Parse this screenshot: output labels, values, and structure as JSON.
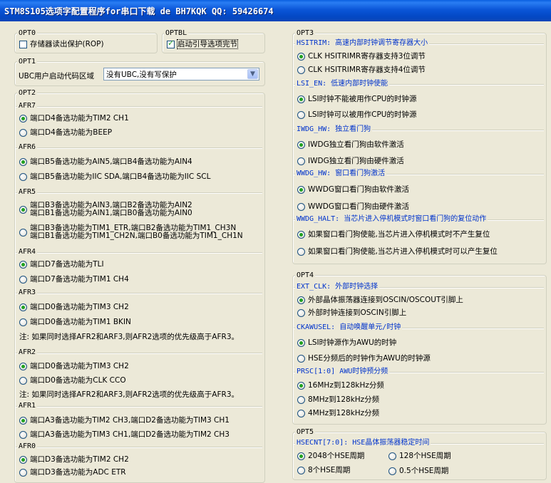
{
  "window": {
    "title": "STM8S105选项字配置程序for串口下载 de BH7KQK QQ: 59426674"
  },
  "opt0": {
    "title": "OPT0",
    "rop": {
      "label": "存储器读出保护(ROP)",
      "checked": false
    }
  },
  "optbl": {
    "title": "OPTBL",
    "boot": {
      "label": "启动引导选项完节",
      "checked": true
    }
  },
  "opt1": {
    "title": "OPT1",
    "ubc_label": "UBC用户启动代码区域",
    "ubc_value": "没有UBC,没有写保护"
  },
  "opt2": {
    "title": "OPT2",
    "afr7": {
      "title": "AFR7",
      "options": [
        "端口D4备选功能为TIM2 CH1",
        "端口D4备选功能为BEEP"
      ],
      "selected": 0
    },
    "afr6": {
      "title": "AFR6",
      "options": [
        "端口B5备选功能为AIN5,端口B4备选功能为AIN4",
        "端口B5备选功能为IIC SDA,端口B4备选功能为IIC SCL"
      ],
      "selected": 0
    },
    "afr5": {
      "title": "AFR5",
      "options": [
        [
          "端口B3备选功能为AIN3,端口B2备选功能为AIN2",
          "端口B1备选功能为AIN1,端口B0备选功能为AIN0"
        ],
        [
          "端口B3备选功能为TIM1_ETR,端口B2备选功能为TIM1_CH3N",
          "端口B1备选功能为TIM1_CH2N,端口B0备选功能为TIM1_CH1N"
        ]
      ],
      "selected": 0
    },
    "afr4": {
      "title": "AFR4",
      "options": [
        "端口D7备选功能为TLI",
        "端口D7备选功能为TIM1 CH4"
      ],
      "selected": 0
    },
    "afr3": {
      "title": "AFR3",
      "options": [
        "端口D0备选功能为TIM3 CH2",
        "端口D0备选功能为TIM1 BKIN"
      ],
      "selected": 0,
      "note": "注: 如果同时选择AFR2和ARF3,则AFR2选项的优先级高于AFR3。"
    },
    "afr2": {
      "title": "AFR2",
      "options": [
        "端口D0备选功能为TIM3 CH2",
        "端口D0备选功能为CLK CCO"
      ],
      "selected": 0,
      "note": "注: 如果同时选择AFR2和ARF3,则AFR2选项的优先级高于AFR3。"
    },
    "afr1": {
      "title": "AFR1",
      "options": [
        "端口A3备选功能为TIM2 CH3,端口D2备选功能为TIM3 CH1",
        "端口A3备选功能为TIM3 CH1,端口D2备选功能为TIM2 CH3"
      ],
      "selected": 0
    },
    "afr0": {
      "title": "AFR0",
      "options": [
        "端口D3备选功能为TIM2 CH2",
        "端口D3备选功能为ADC ETR"
      ],
      "selected": 0
    }
  },
  "opt3": {
    "title": "OPT3",
    "hsitrim": {
      "title": "HSITRIM: 高速内部时钟调节寄存器大小",
      "options": [
        "CLK HSITRIMR寄存器支持3位调节",
        "CLK HSITRIMR寄存器支持4位调节"
      ],
      "selected": 0
    },
    "lsi_en": {
      "title": "LSI_EN: 低速内部时钟使能",
      "options": [
        "LSI时钟不能被用作CPU的时钟源",
        "LSI时钟可以被用作CPU的时钟源"
      ],
      "selected": 0
    },
    "iwdg_hw": {
      "title": "IWDG_HW: 独立看门狗",
      "options": [
        "IWDG独立看门狗由软件激活",
        "IWDG独立看门狗由硬件激活"
      ],
      "selected": 0
    },
    "wwdg_hw": {
      "title": "WWDG_HW: 窗口看门狗激活",
      "options": [
        "WWDG窗口看门狗由软件激活",
        "WWDG窗口看门狗由硬件激活"
      ],
      "selected": 0
    },
    "wwdg_halt": {
      "title": "WWDG_HALT: 当芯片进入停机模式时窗口看门狗的复位动作",
      "options": [
        "如果窗口看门狗使能,当芯片进入停机模式时不产生复位",
        "如果窗口看门狗使能,当芯片进入停机模式时可以产生复位"
      ],
      "selected": 0
    }
  },
  "opt4": {
    "title": "OPT4",
    "ext_clk": {
      "title": "EXT_CLK: 外部时钟选择",
      "options": [
        "外部晶体振荡器连接到OSCIN/OSCOUT引脚上",
        "外部时钟连接到OSCIN引脚上"
      ],
      "selected": 0
    },
    "ckawusel": {
      "title": "CKAWUSEL: 自动唤醒单元/时钟",
      "options": [
        "LSI时钟源作为AWU的时钟",
        "HSE分频后的时钟作为AWU的时钟源"
      ],
      "selected": 0
    },
    "prsc": {
      "title": "PRSC[1:0] AWU时钟预分频",
      "options": [
        "16MHz到128kHz分频",
        "8MHz到128kHz分频",
        "4MHz到128kHz分频"
      ],
      "selected": 0
    }
  },
  "opt5": {
    "title": "OPT5",
    "hsecnt": {
      "title": "HSECNT[7:0]: HSE晶体振荡器稳定时间",
      "options": [
        "2048个HSE周期",
        "128个HSE周期",
        "8个HSE周期",
        "0.5个HSE周期"
      ],
      "selected": 0
    }
  }
}
